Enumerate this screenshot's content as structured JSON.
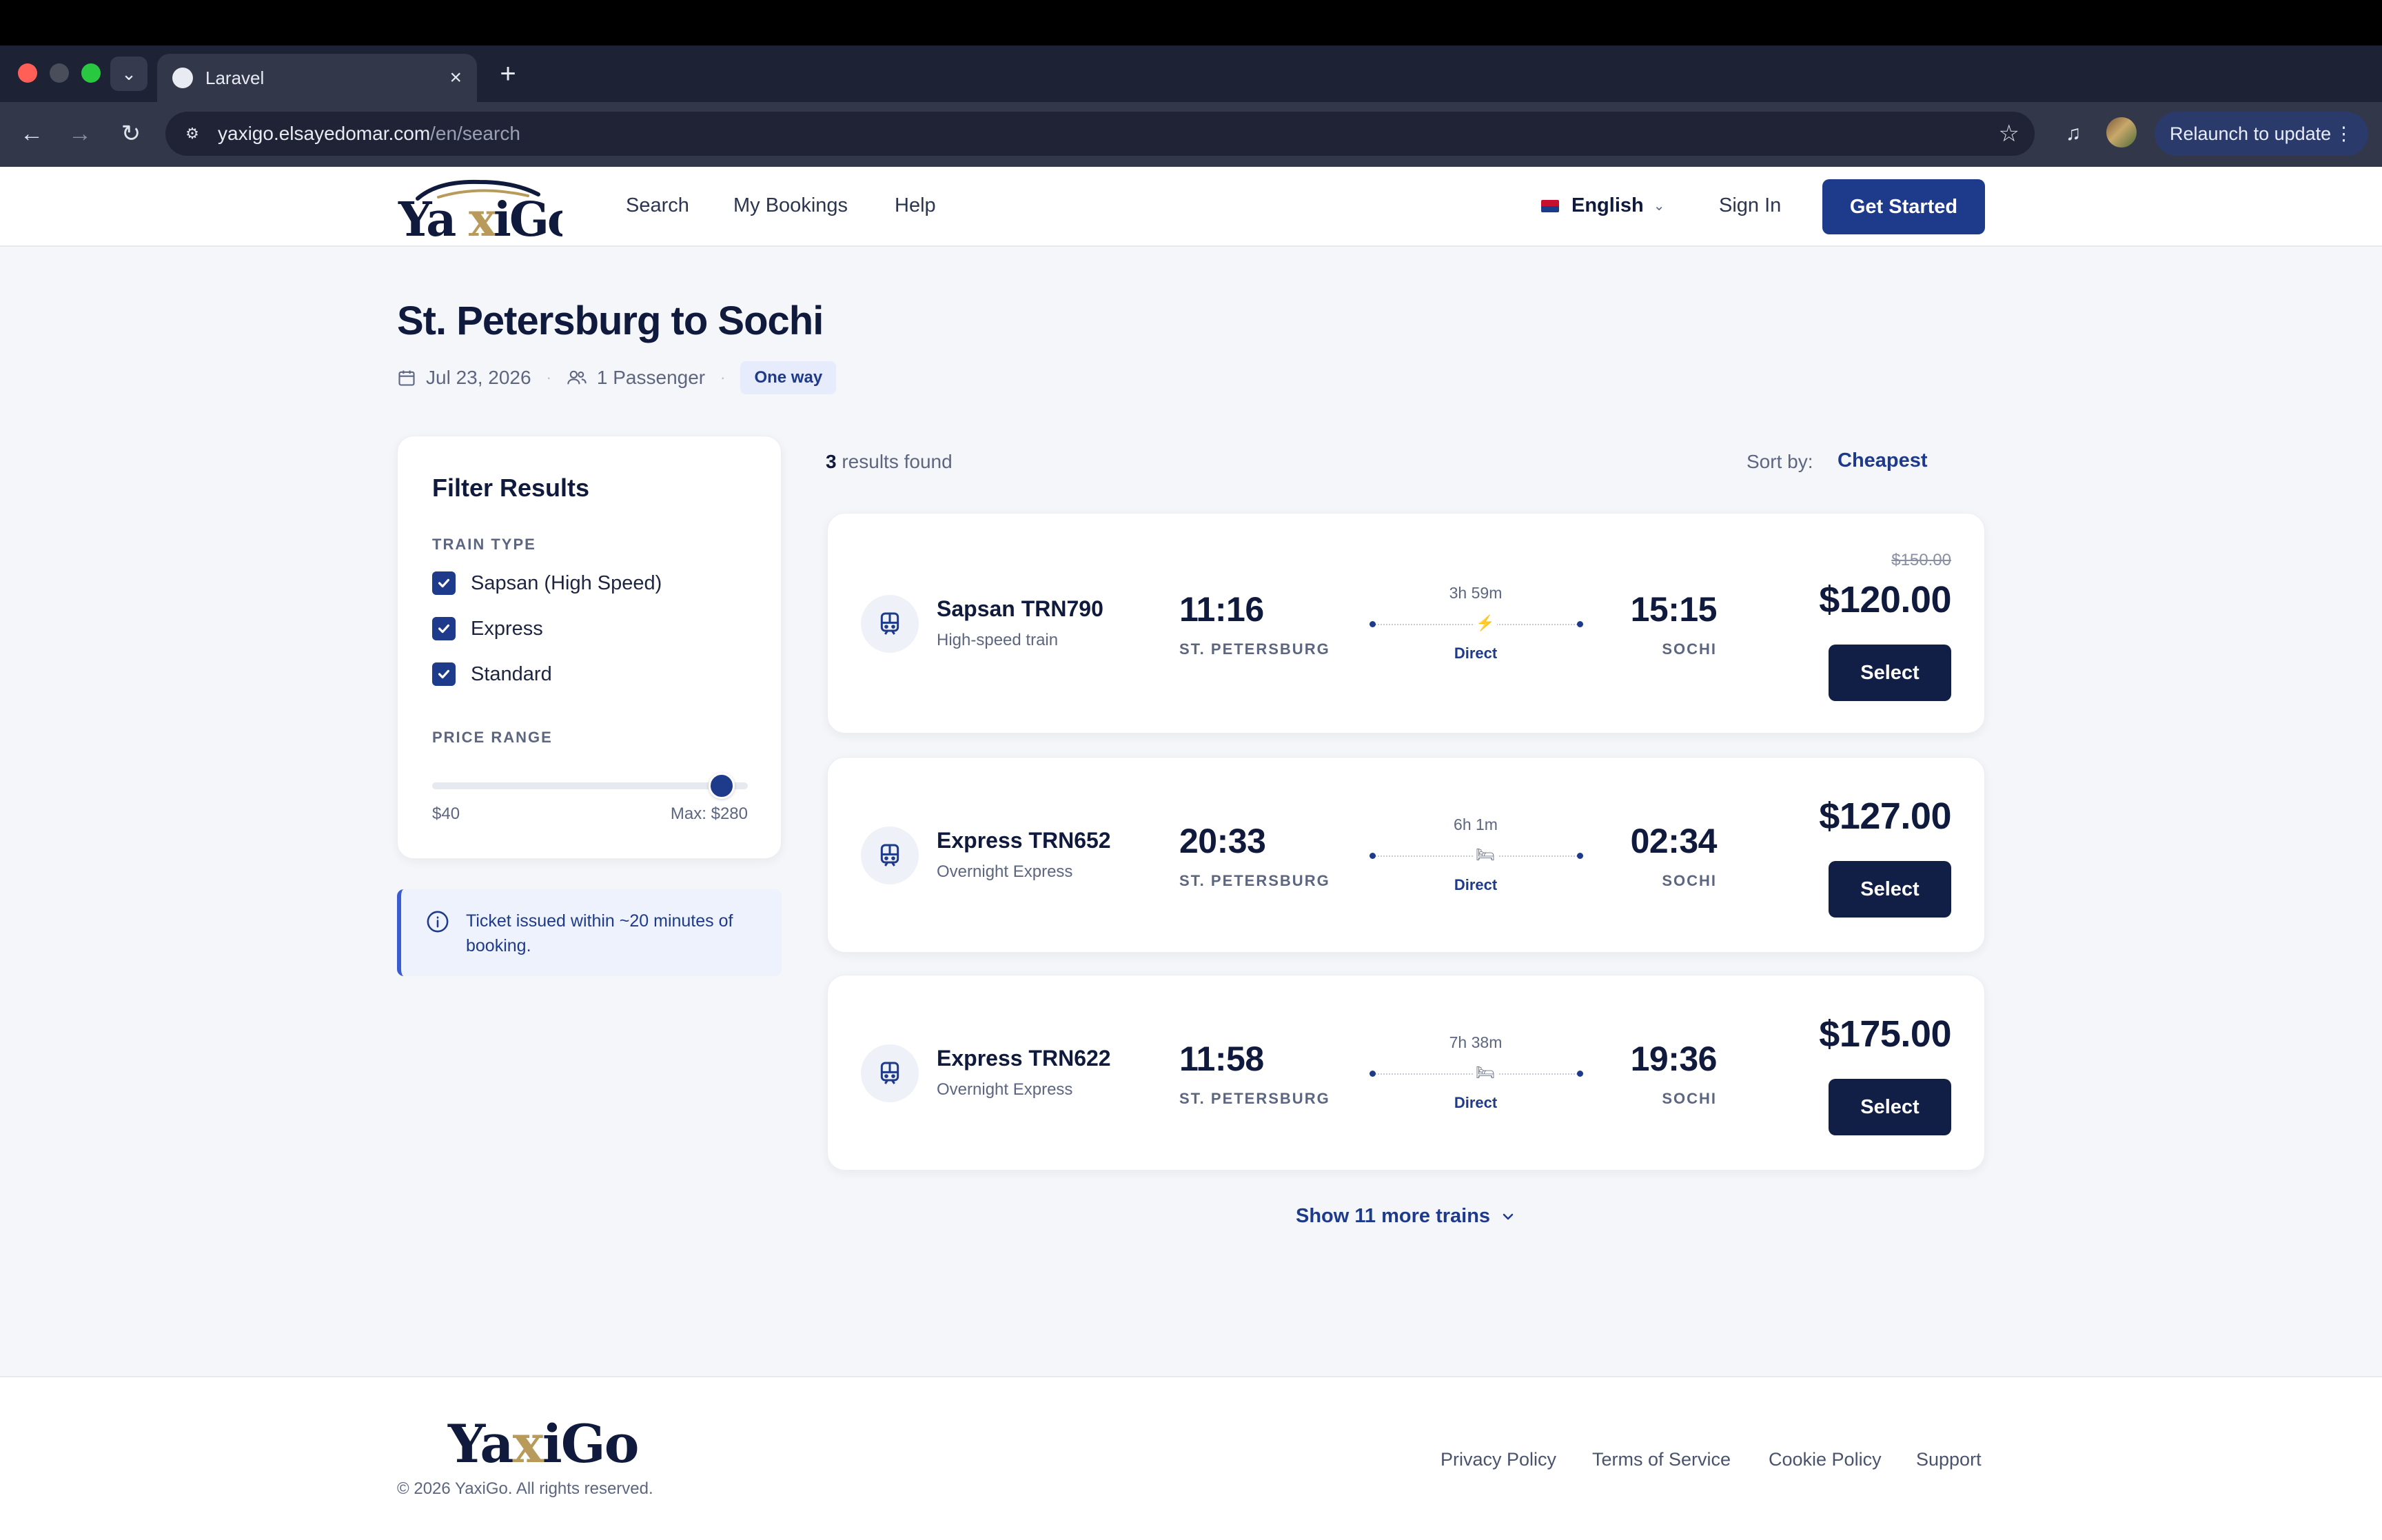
{
  "browser": {
    "tab_title": "Laravel",
    "url_host": "yaxigo.elsayedomar.com",
    "url_path": "/en/search",
    "relaunch_label": "Relaunch to update"
  },
  "header": {
    "logo_text": "YaxiGo",
    "nav": [
      "Search",
      "My Bookings",
      "Help"
    ],
    "language": "English",
    "sign_in": "Sign In",
    "get_started": "Get Started"
  },
  "search": {
    "title": "St. Petersburg to Sochi",
    "date": "Jul 23, 2026",
    "passengers": "1 Passenger",
    "trip_type": "One way"
  },
  "filters": {
    "title": "Filter Results",
    "train_type_label": "TRAIN TYPE",
    "train_types": [
      {
        "label": "Sapsan (High Speed)",
        "checked": true
      },
      {
        "label": "Express",
        "checked": true
      },
      {
        "label": "Standard",
        "checked": true
      }
    ],
    "price_range_label": "PRICE RANGE",
    "price_min_label": "$40",
    "price_max_label": "Max: $280",
    "price_min": 40,
    "price_max": 280,
    "price_current": 260
  },
  "info": {
    "text": "Ticket issued within ~20 minutes of booking."
  },
  "results": {
    "count": "3",
    "count_suffix": " results found",
    "sort_label": "Sort by:",
    "sort_value": "Cheapest",
    "trains": [
      {
        "name": "Sapsan TRN790",
        "type": "High-speed train",
        "dep_time": "11:16",
        "dep_city": "ST. PETERSBURG",
        "duration": "3h 59m",
        "stops": "Direct",
        "arr_time": "15:15",
        "arr_city": "SOCHI",
        "old_price": "$150.00",
        "price": "$120.00",
        "select": "Select"
      },
      {
        "name": "Express TRN652",
        "type": "Overnight Express",
        "dep_time": "20:33",
        "dep_city": "ST. PETERSBURG",
        "duration": "6h 1m",
        "stops": "Direct",
        "arr_time": "02:34",
        "arr_city": "SOCHI",
        "price": "$127.00",
        "select": "Select"
      },
      {
        "name": "Express TRN622",
        "type": "Overnight Express",
        "dep_time": "11:58",
        "dep_city": "ST. PETERSBURG",
        "duration": "7h 38m",
        "stops": "Direct",
        "arr_time": "19:36",
        "arr_city": "SOCHI",
        "price": "$175.00",
        "select": "Select"
      }
    ],
    "show_more": "Show 11 more trains"
  },
  "footer": {
    "logo_text": "YaxiGo",
    "copyright": "© 2026 YaxiGo. All rights reserved.",
    "links": [
      "Privacy Policy",
      "Terms of Service",
      "Cookie Policy",
      "Support"
    ]
  },
  "colors": {
    "primary": "#1e3a8a",
    "dark_button": "#111e45",
    "gold": "#b89a5a"
  }
}
